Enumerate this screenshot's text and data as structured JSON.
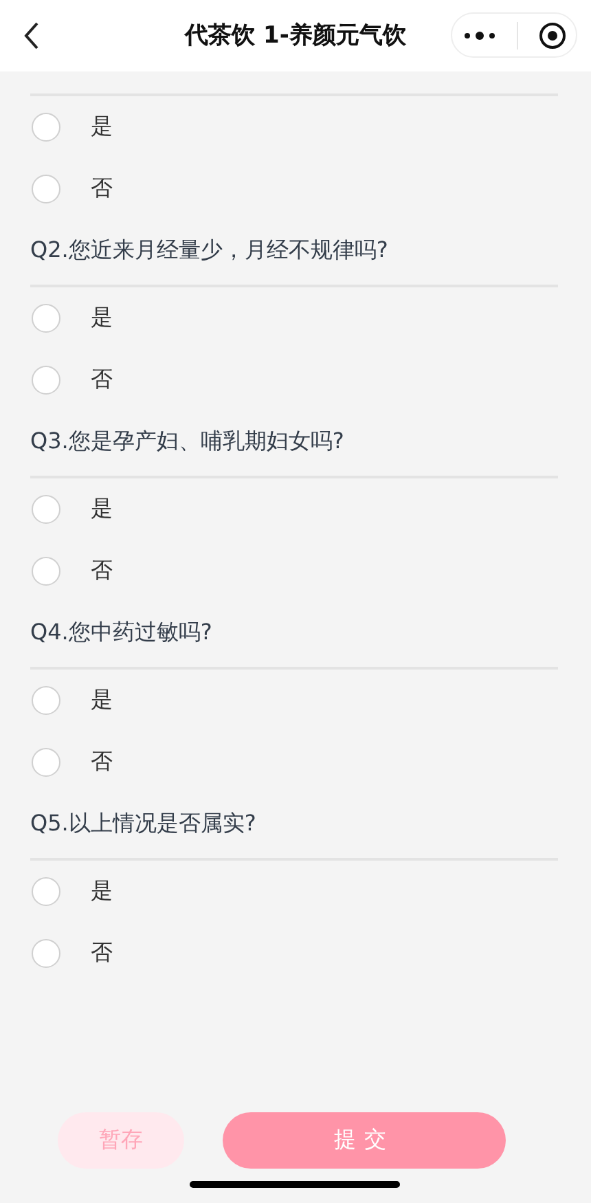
{
  "header": {
    "title": "代茶饮 1-养颜元气饮"
  },
  "questions": [
    {
      "options": [
        {
          "label": "是",
          "selected": false
        },
        {
          "label": "否",
          "selected": false
        }
      ]
    },
    {
      "text": "Q2.您近来月经量少，月经不规律吗?",
      "options": [
        {
          "label": "是",
          "selected": false
        },
        {
          "label": "否",
          "selected": false
        }
      ]
    },
    {
      "text": "Q3.您是孕产妇、哺乳期妇女吗?",
      "options": [
        {
          "label": "是",
          "selected": false
        },
        {
          "label": "否",
          "selected": false
        }
      ]
    },
    {
      "text": "Q4.您中药过敏吗?",
      "options": [
        {
          "label": "是",
          "selected": false
        },
        {
          "label": "否",
          "selected": false
        }
      ]
    },
    {
      "text": "Q5.以上情况是否属实?",
      "options": [
        {
          "label": "是",
          "selected": false
        },
        {
          "label": "否",
          "selected": false
        }
      ]
    }
  ],
  "buttons": {
    "save": "暂存",
    "submit": "提交"
  }
}
